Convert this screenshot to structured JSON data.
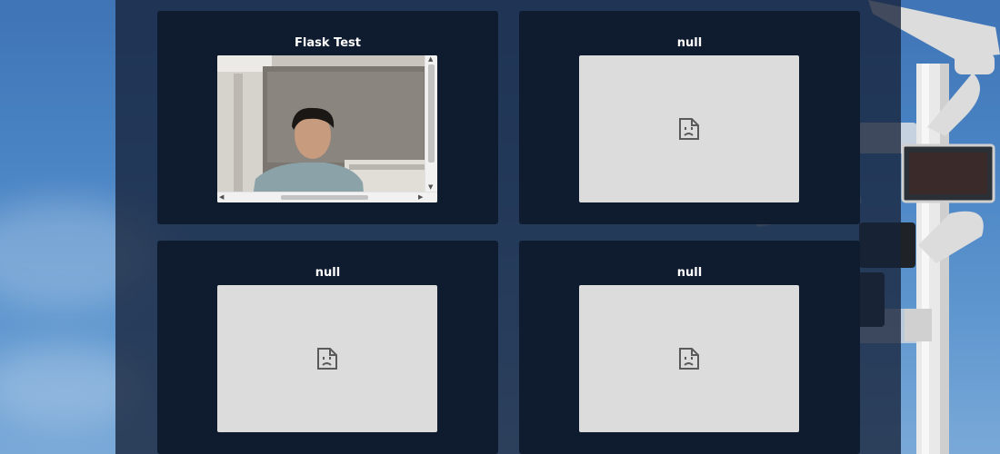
{
  "cards": [
    {
      "title": "Flask Test",
      "content": "video-stream"
    },
    {
      "title": "null",
      "content": "broken-image"
    },
    {
      "title": "null",
      "content": "broken-image"
    },
    {
      "title": "null",
      "content": "broken-image"
    }
  ],
  "icons": {
    "broken_image": "broken-image-icon",
    "scroll_up": "▲",
    "scroll_down": "▼",
    "scroll_left": "◀",
    "scroll_right": "▶"
  },
  "colors": {
    "panel": "#17233a",
    "card": "#0f1c30",
    "placeholder": "#dcdcdc",
    "title_text": "#ffffff"
  }
}
